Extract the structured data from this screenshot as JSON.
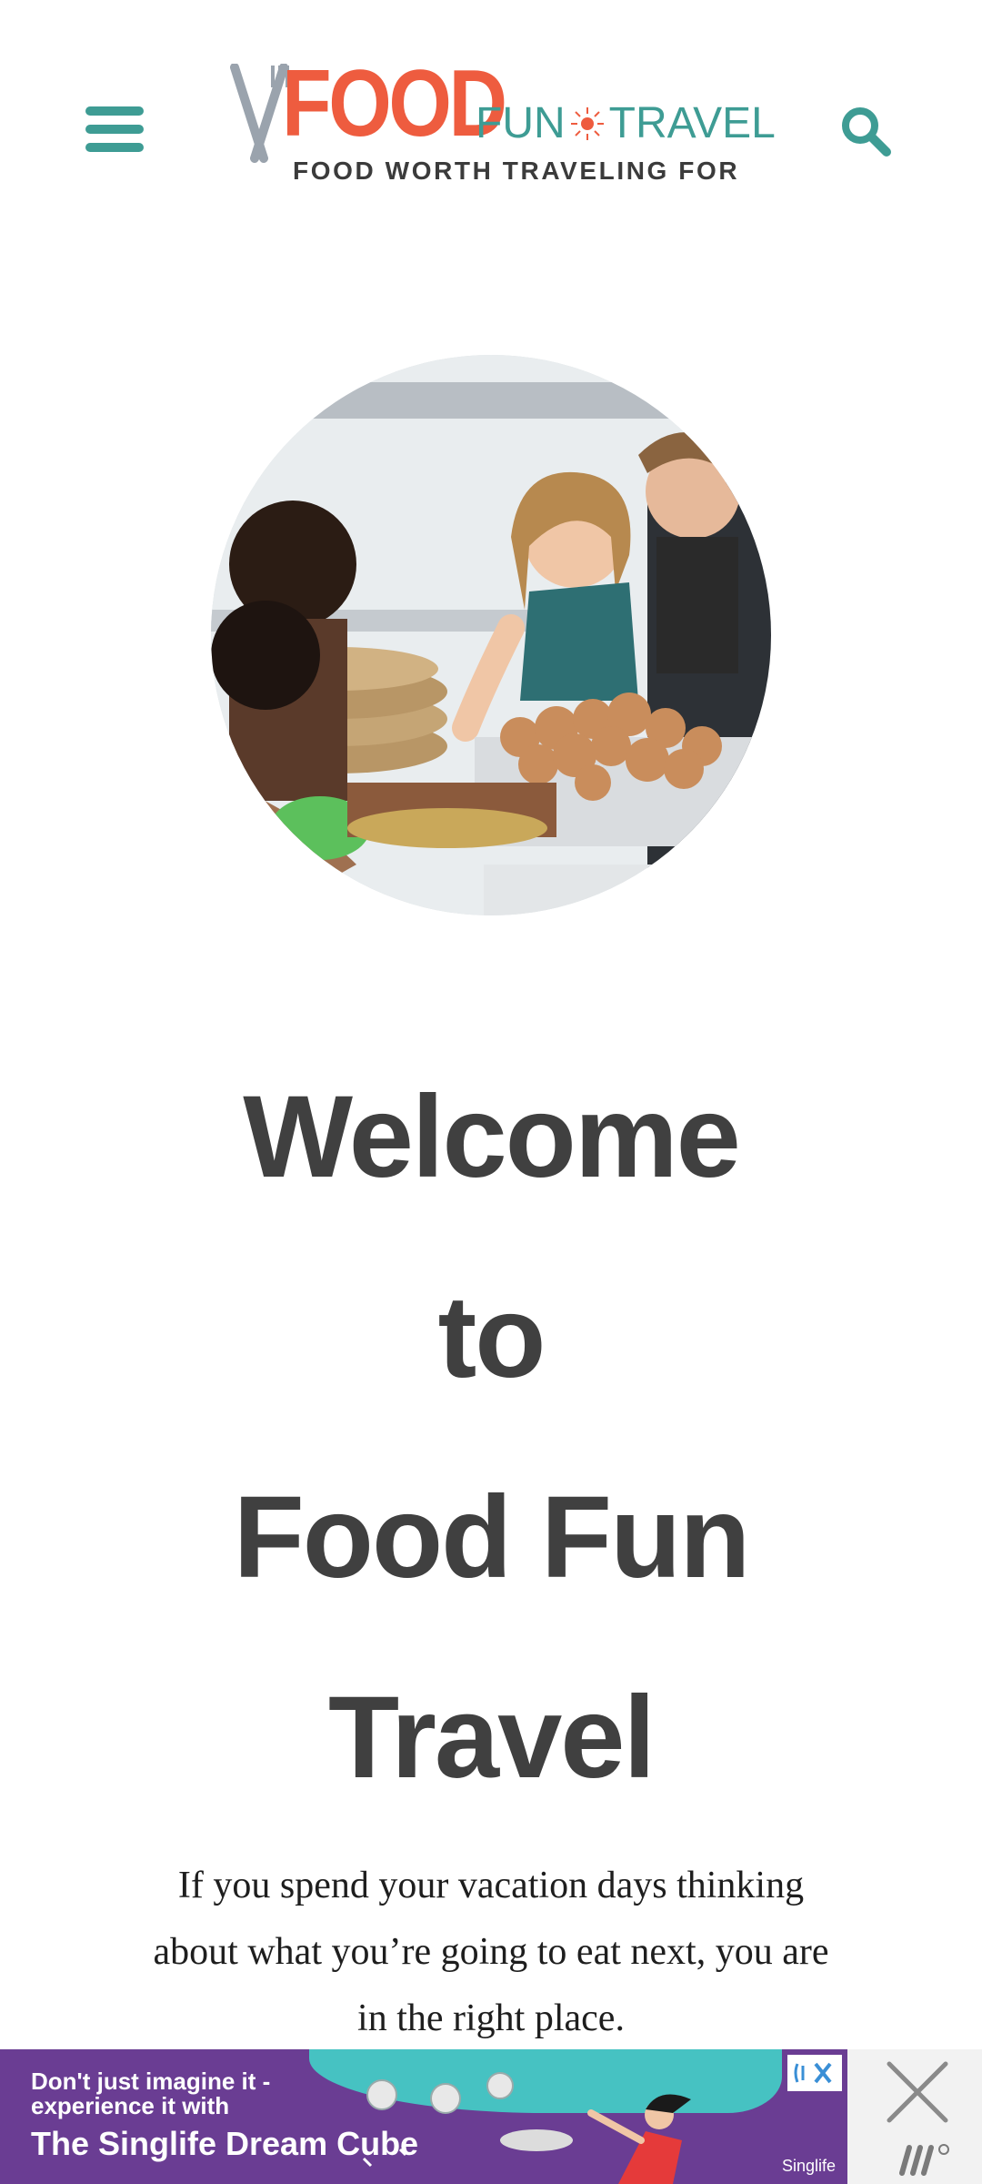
{
  "header": {
    "logo": {
      "main": "FOOD",
      "sub_left": "FUN",
      "sub_right": "TRAVEL",
      "tagline": "FOOD WORTH TRAVELING FOR"
    },
    "menu_icon": "hamburger-menu-icon",
    "search_icon": "search-icon"
  },
  "hero": {
    "alt": "People sharing food at a market stall"
  },
  "headline": {
    "line1": "Welcome",
    "line2": "to",
    "line3": "Food Fun",
    "line4": "Travel"
  },
  "intro": "If you spend your vacation days thinking about what you’re going to eat next, you are in the right place.",
  "ad": {
    "line1": "Don't just imagine it - experience it with",
    "line2": "The Singlife Dream Cube",
    "brand": "Singlife",
    "close_icon": "close-icon",
    "choices_icon": "ad-choices-icon"
  },
  "colors": {
    "accent": "#3e9c94",
    "brand": "#ee5c3f",
    "heading": "#404040",
    "ad_bg": "#6a3d93"
  }
}
